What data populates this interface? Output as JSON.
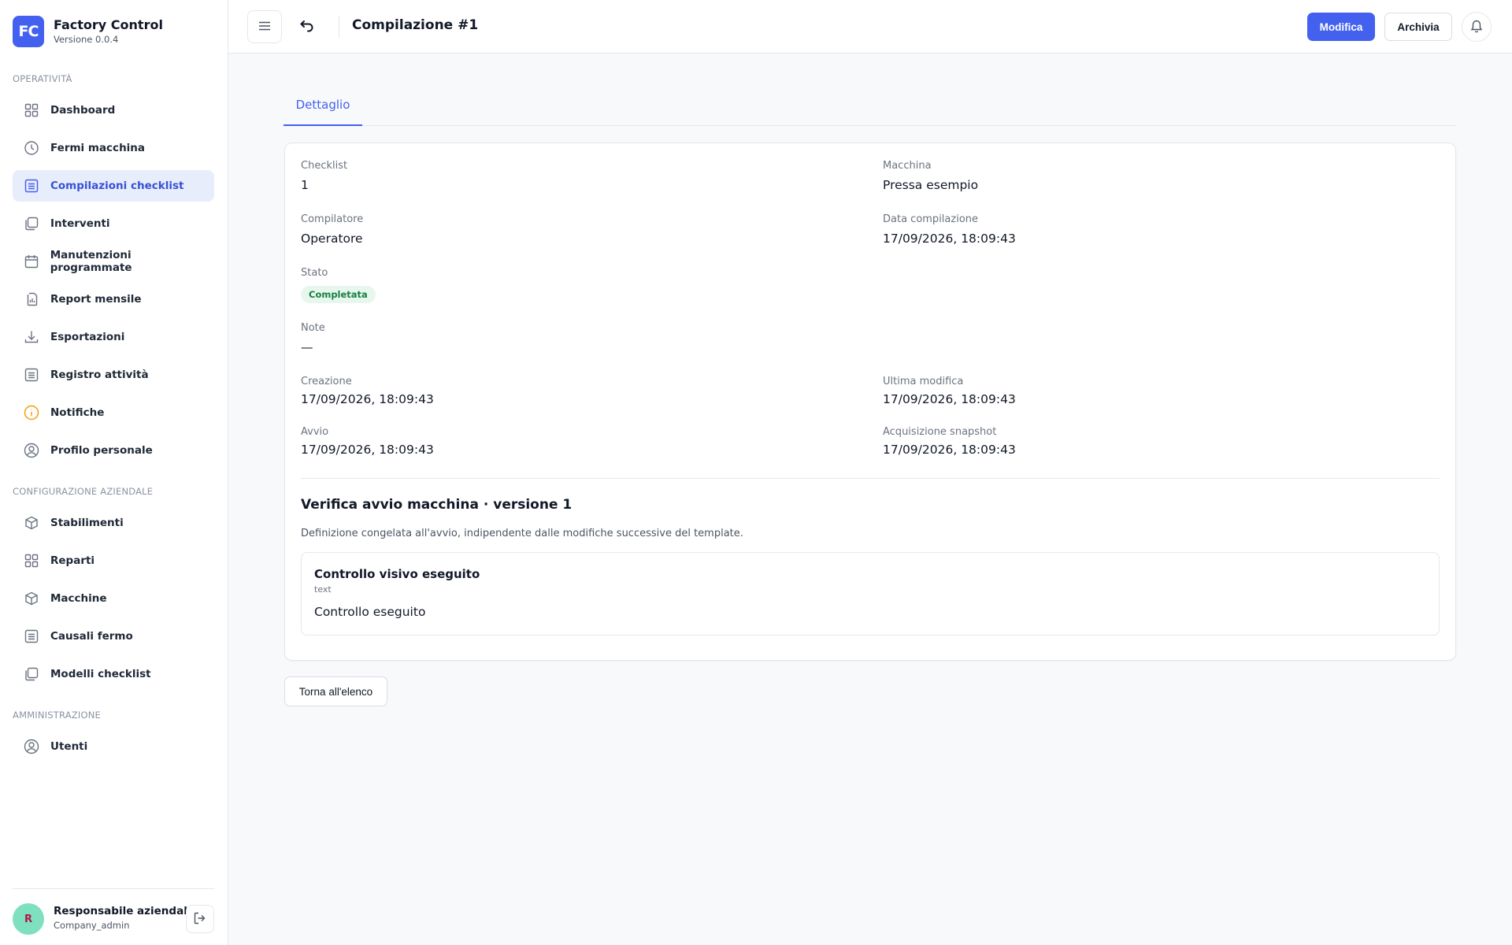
{
  "app": {
    "logo_text": "FC",
    "name": "Factory Control",
    "version": "Versione 0.0.4"
  },
  "sidebar": {
    "sections": [
      {
        "label": "OPERATIVITÀ"
      },
      {
        "label": "CONFIGURAZIONE AZIENDALE"
      },
      {
        "label": "AMMINISTRAZIONE"
      }
    ],
    "items": [
      {
        "label": "Dashboard",
        "icon": "grid-icon"
      },
      {
        "label": "Fermi macchina",
        "icon": "clock-icon"
      },
      {
        "label": "Compilazioni checklist",
        "icon": "list-icon"
      },
      {
        "label": "Interventi",
        "icon": "copy-icon"
      },
      {
        "label": "Manutenzioni programmate",
        "icon": "calendar-icon"
      },
      {
        "label": "Report mensile",
        "icon": "file-chart-icon"
      },
      {
        "label": "Esportazioni",
        "icon": "download-icon"
      },
      {
        "label": "Registro attività",
        "icon": "list-icon"
      },
      {
        "label": "Notifiche",
        "icon": "info-icon"
      },
      {
        "label": "Profilo personale",
        "icon": "user-circle-icon"
      },
      {
        "label": "Stabilimenti",
        "icon": "box-icon"
      },
      {
        "label": "Reparti",
        "icon": "grid-icon"
      },
      {
        "label": "Macchine",
        "icon": "box-icon"
      },
      {
        "label": "Causali fermo",
        "icon": "list-icon"
      },
      {
        "label": "Modelli checklist",
        "icon": "copy-icon"
      },
      {
        "label": "Utenti",
        "icon": "user-circle-icon"
      }
    ],
    "active_item": "Compilazioni checklist",
    "user": {
      "initial": "R",
      "name": "Responsabile aziendale",
      "role": "Company_admin"
    }
  },
  "topbar": {
    "title": "Compilazione #1",
    "primary_label": "Modifica",
    "secondary_label": "Archivia"
  },
  "tabs": [
    {
      "label": "Dettaglio"
    }
  ],
  "detail": {
    "checklist": {
      "label": "Checklist",
      "value": "1"
    },
    "macchina": {
      "label": "Macchina",
      "value": "Pressa esempio"
    },
    "compilatore": {
      "label": "Compilatore",
      "value": "Operatore"
    },
    "data_compilazione": {
      "label": "Data compilazione",
      "value": "17/09/2026, 18:09:43"
    },
    "stato": {
      "label": "Stato",
      "value": "Completata"
    },
    "note": {
      "label": "Note",
      "value": "—"
    },
    "creazione": {
      "label": "Creazione",
      "value": "17/09/2026, 18:09:43"
    },
    "ultima_modifica": {
      "label": "Ultima modifica",
      "value": "17/09/2026, 18:09:43"
    },
    "avvio": {
      "label": "Avvio",
      "value": "17/09/2026, 18:09:43"
    },
    "acquisizione_snapshot": {
      "label": "Acquisizione snapshot",
      "value": "17/09/2026, 18:09:43"
    }
  },
  "snapshot": {
    "title": "Verifica avvio macchina · versione 1",
    "description": "Definizione congelata all'avvio, indipendente dalle modifiche successive del template.",
    "items": [
      {
        "title": "Controllo visivo eseguito",
        "type": "text",
        "value": "Controllo eseguito"
      }
    ]
  },
  "back_button_label": "Torna all'elenco",
  "colors": {
    "accent": "#4361ee",
    "active_bg": "#e8edfc",
    "success_bg": "#e8f7ee",
    "success_text": "#15803d",
    "notification_icon": "#f59e0b"
  }
}
